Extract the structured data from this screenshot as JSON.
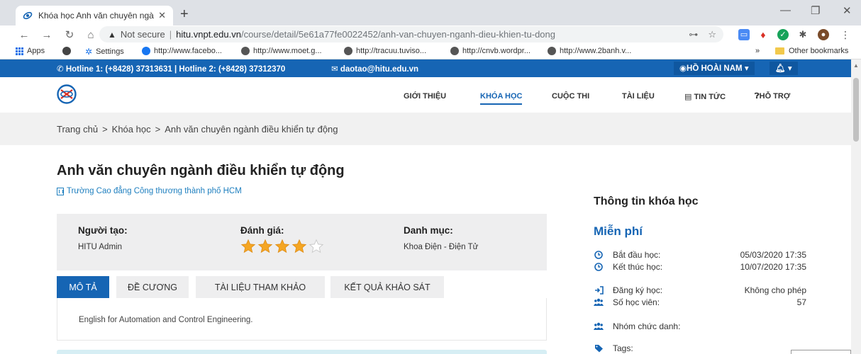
{
  "browser": {
    "tab_title": "Khóa học Anh văn chuyên ngành",
    "address": {
      "security": "Not secure",
      "host": "hitu.vnpt.edu.vn",
      "path": "/course/detail/5e61a77fe0022452/anh-van-chuyen-nganh-dieu-khien-tu-dong"
    },
    "bookmarks": [
      {
        "label": "Apps"
      },
      {
        "label": ""
      },
      {
        "label": "Settings"
      },
      {
        "label": "http://www.facebo..."
      },
      {
        "label": "http://www.moet.g..."
      },
      {
        "label": "http://tracuu.tuviso..."
      },
      {
        "label": "http://cnvb.wordpr..."
      },
      {
        "label": "http://www.2banh.v..."
      }
    ],
    "overflow": "»",
    "other_bookmarks": "Other bookmarks"
  },
  "site": {
    "hotline": "Hotline 1: (+8428) 37313631 | Hotline 2: (+8428) 37312370",
    "email": "daotao@hitu.edu.vn",
    "user_name": "HỒ HOÀI NAM",
    "nav": [
      {
        "label": "GIỚI THIỆU"
      },
      {
        "label": "KHÓA HỌC"
      },
      {
        "label": "CUỘC THI"
      },
      {
        "label": "TÀI LIỆU"
      },
      {
        "label": "TIN TỨC"
      },
      {
        "label": "HỖ TRỢ"
      }
    ],
    "nav_active": "KHÓA HỌC"
  },
  "breadcrumb": [
    "Trang chủ",
    "Khóa học",
    "Anh văn chuyên ngành điều khiển tự động"
  ],
  "breadcrumb_sep": ">",
  "course": {
    "title": "Anh văn chuyên ngành điều khiển tự động",
    "school": "Trường Cao đẳng Công thương thành phố HCM",
    "creator_label": "Người tạo:",
    "creator": "HITU Admin",
    "rating_label": "Đánh giá:",
    "rating": 4,
    "rating_max": 5,
    "category_label": "Danh mục:",
    "category": "Khoa Điện - Điện Tử",
    "tabs": [
      {
        "label": "MÔ TẢ"
      },
      {
        "label": "ĐỀ CƯƠNG"
      },
      {
        "label": "TÀI LIỆU THAM KHẢO"
      },
      {
        "label": "KẾT QUẢ KHẢO SÁT"
      }
    ],
    "active_tab": "MÔ TẢ",
    "description": "English for Automation and Control Engineering."
  },
  "sidebar": {
    "title": "Thông tin khóa học",
    "price": "Miễn phí",
    "start_label": "Bắt đầu học:",
    "start": "05/03/2020 17:35",
    "end_label": "Kết thúc học:",
    "end": "10/07/2020 17:35",
    "register_label": "Đăng ký học:",
    "register": "Không cho phép",
    "students_label": "Số học viên:",
    "students": "57",
    "group_label": "Nhóm chức danh:",
    "tags_label": "Tags:"
  },
  "colors": {
    "primary": "#1665b4",
    "star": "#f5a623",
    "link": "#1e7fbf",
    "panel": "#eeeeef"
  }
}
